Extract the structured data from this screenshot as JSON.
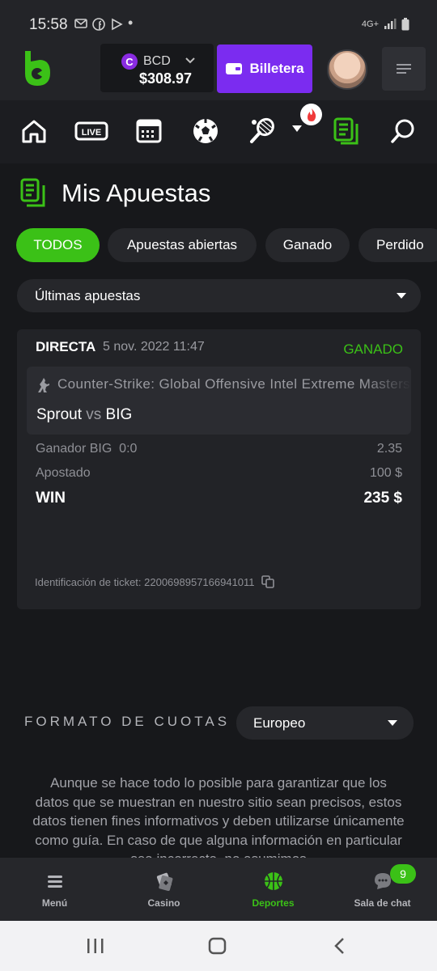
{
  "status_bar": {
    "time": "15:58",
    "network": "4G+"
  },
  "header": {
    "currency": "BCD",
    "balance": "$308.97",
    "wallet_label": "Billetera"
  },
  "page": {
    "title": "Mis Apuestas"
  },
  "filters": {
    "chips": [
      "TODOS",
      "Apuestas abiertas",
      "Ganado",
      "Perdido"
    ],
    "active": "TODOS"
  },
  "period_select": {
    "value": "Últimas apuestas"
  },
  "bet": {
    "type": "DIRECTA",
    "date": "5 nov. 2022 11:47",
    "status": "GANADO",
    "league": "Counter-Strike: Global Offensive Intel Extreme Masters",
    "team1": "Sprout",
    "vs": "vs",
    "team2": "BIG",
    "market": "Ganador BIG  0:0",
    "odds": "2.35",
    "stake_label": "Apostado",
    "stake": "100 $",
    "win_label": "WIN",
    "win": "235 $",
    "ticket": "Identificación de ticket: 220069895716694101​1"
  },
  "odds_format": {
    "label": "FORMATO DE CUOTAS",
    "value": "Europeo"
  },
  "disclaimer": "Aunque se hace todo lo posible para garantizar que los datos que se muestran en nuestro sitio sean precisos, estos datos tienen fines informativos y deben utilizarse únicamente como guía. En caso de que alguna información en particular sea incorrecta, no asumimos",
  "tabbar": {
    "menu": "Menú",
    "casino": "Casino",
    "sports": "Deportes",
    "chat": "Sala de chat",
    "chat_badge": "9"
  },
  "colors": {
    "accent": "#3bc117",
    "wallet": "#7b2cf0",
    "bg": "#17181b",
    "card": "#222327"
  }
}
